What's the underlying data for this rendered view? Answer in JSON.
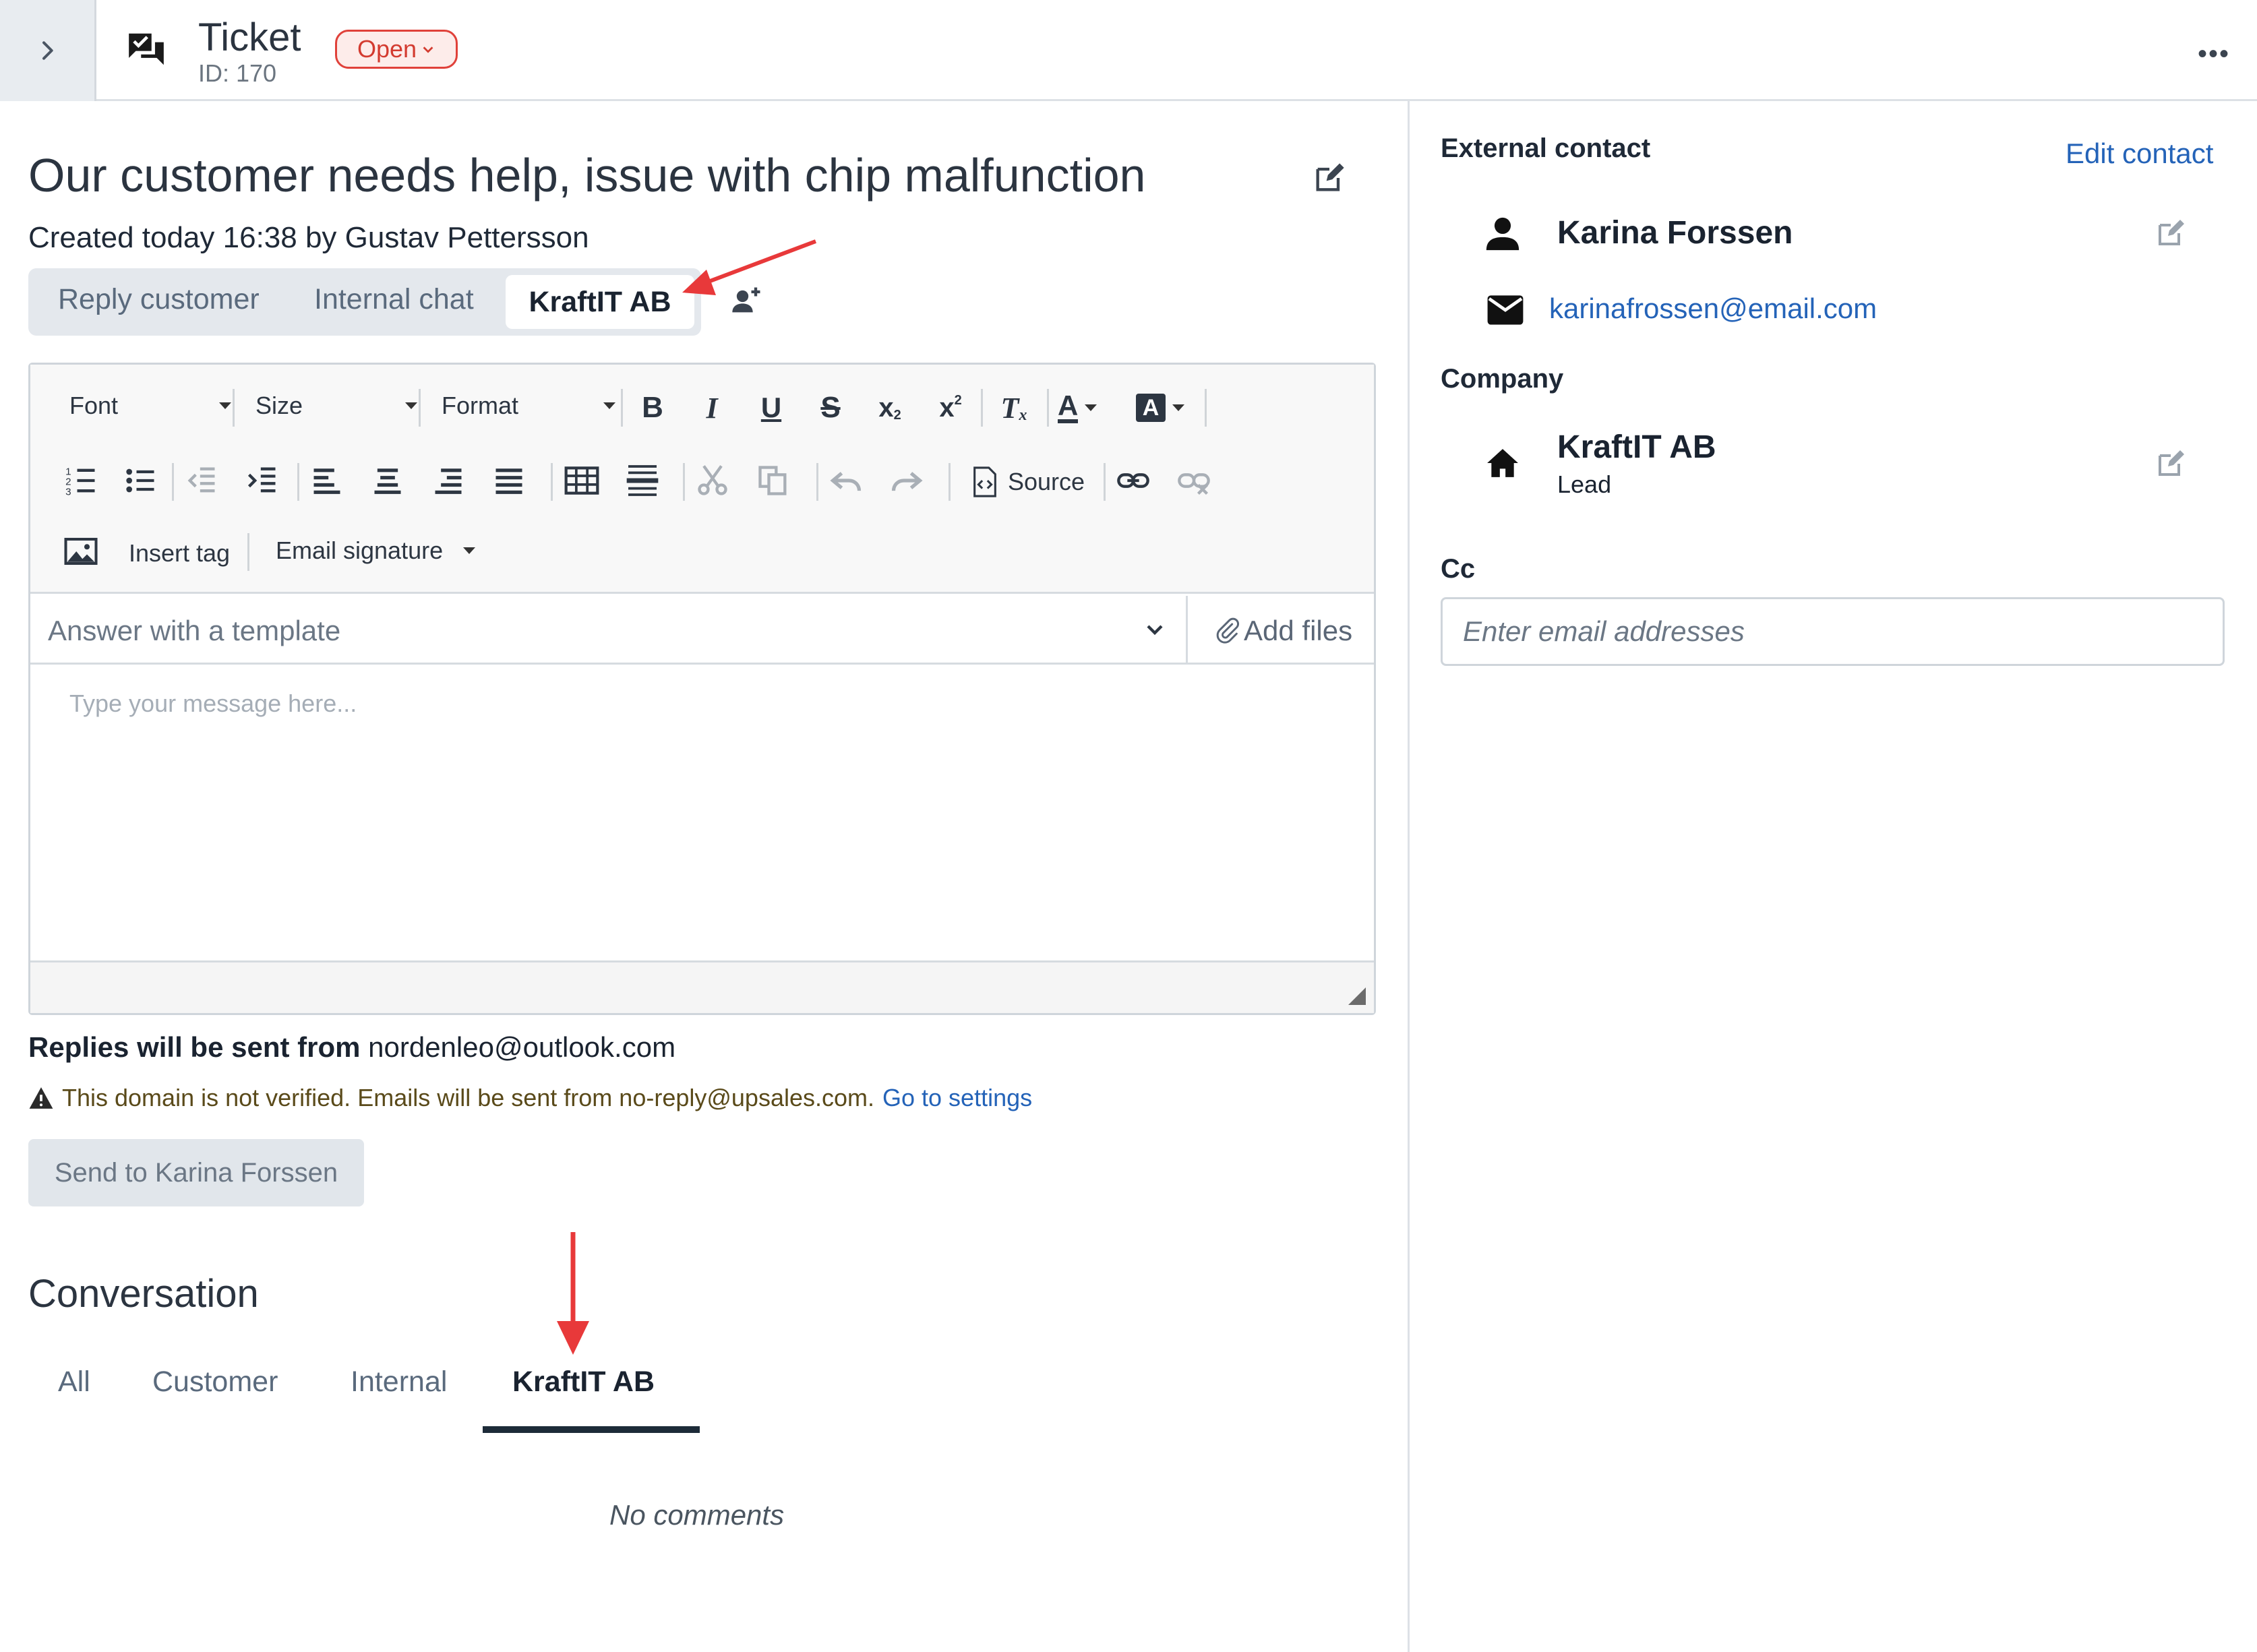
{
  "header": {
    "title": "Ticket",
    "id_label": "ID: 170",
    "status": "Open",
    "more_label": "•••"
  },
  "ticket": {
    "subject": "Our customer needs help, issue with chip malfunction",
    "created": "Created today 16:38 by Gustav Pettersson"
  },
  "reply_tabs": [
    {
      "label": "Reply customer",
      "active": false
    },
    {
      "label": "Internal chat",
      "active": false
    },
    {
      "label": "KraftIT AB",
      "active": true
    }
  ],
  "toolbar": {
    "font": "Font",
    "size": "Size",
    "format": "Format",
    "source": "Source",
    "insert_tag": "Insert tag",
    "email_signature": "Email signature"
  },
  "template": {
    "placeholder": "Answer with a template",
    "add_files": "Add files"
  },
  "message": {
    "placeholder": "Type your message here..."
  },
  "replies": {
    "label": "Replies will be sent from",
    "address": "nordenleo@outlook.com"
  },
  "warning": {
    "text": "This domain is not verified. Emails will be sent from no-reply@upsales.com.",
    "link": "Go to settings"
  },
  "send_button": "Send to Karina Forssen",
  "conversation": {
    "title": "Conversation",
    "tabs": [
      {
        "label": "All",
        "active": false
      },
      {
        "label": "Customer",
        "active": false
      },
      {
        "label": "Internal",
        "active": false
      },
      {
        "label": "KraftIT AB",
        "active": true
      }
    ],
    "empty": "No comments"
  },
  "sidebar": {
    "external_contact_heading": "External contact",
    "edit_contact": "Edit contact",
    "contact_name": "Karina Forssen",
    "contact_email": "karinafrossen@email.com",
    "company_heading": "Company",
    "company_name": "KraftIT AB",
    "company_status": "Lead",
    "cc_heading": "Cc",
    "cc_placeholder": "Enter email addresses"
  },
  "colors": {
    "accent_link": "#2463b8",
    "status_red": "#e0413a",
    "annotation_arrow": "#e8393a"
  }
}
